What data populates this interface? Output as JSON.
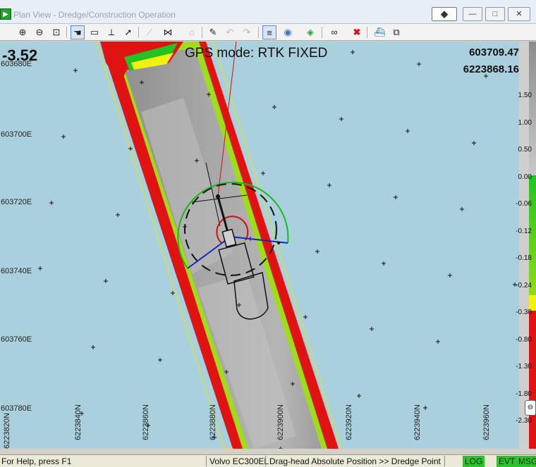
{
  "window": {
    "title": "Plan View - Dredge/Construction Operation",
    "pin_label": "◆",
    "minimize_label": "—",
    "maximize_label": "□",
    "close_label": "✕"
  },
  "toolbar": {
    "tools": [
      {
        "name": "zoom-in-icon",
        "glyph": "⊕"
      },
      {
        "name": "zoom-out-icon",
        "glyph": "⊖"
      },
      {
        "name": "zoom-window-icon",
        "glyph": "⊡"
      },
      {
        "name": "pan-hand-icon",
        "glyph": "☚"
      },
      {
        "name": "measure-icon",
        "glyph": "▭"
      },
      {
        "name": "ruler-icon",
        "glyph": "⟂"
      },
      {
        "name": "pointer-icon",
        "glyph": "➚"
      },
      {
        "name": "draw-line-icon",
        "glyph": "⟋"
      },
      {
        "name": "network-icon",
        "glyph": "⋈"
      },
      {
        "name": "house-icon",
        "glyph": "⌂"
      },
      {
        "name": "edit-icon",
        "glyph": "✎"
      },
      {
        "name": "undo-icon",
        "glyph": "↶"
      },
      {
        "name": "redo-icon",
        "glyph": "↷"
      },
      {
        "name": "layers-icon",
        "glyph": "≡"
      },
      {
        "name": "color-palette-icon",
        "glyph": "◉"
      },
      {
        "name": "paint-icon",
        "glyph": "◈"
      },
      {
        "name": "binoculars-icon",
        "glyph": "∞"
      },
      {
        "name": "delete-icon",
        "glyph": "✖"
      },
      {
        "name": "vessel-icon",
        "glyph": "⛴"
      },
      {
        "name": "windows-icon",
        "glyph": "⧉"
      }
    ]
  },
  "map": {
    "depth_value": "-3.52",
    "gps_mode": "GPS mode: RTK FIXED",
    "easting": "603709.47",
    "northing": "6223868.16",
    "easting_labels": [
      "603680E",
      "603700E",
      "603720E",
      "603740E",
      "603760E",
      "603780E"
    ],
    "northing_labels": [
      "6223820N",
      "6223840N",
      "6223860N",
      "6223880N",
      "6223900N",
      "6223920N",
      "6223940N",
      "6223960N"
    ]
  },
  "legend": {
    "labels": [
      "1.50",
      "1.00",
      "0.50",
      "0.00",
      "-0.06",
      "-0.12",
      "-0.18",
      "-0.24",
      "-0.30",
      "-0.80",
      "-1.30",
      "-1.80",
      "-2.30"
    ],
    "colors": {
      "gray_light": "#c8c8c8",
      "gray_mid": "#9a9a9a",
      "green": "#22c322",
      "lime": "#9fdc1b",
      "yellow": "#f1f10f",
      "red": "#e01313"
    }
  },
  "statusbar": {
    "help": "For Help, press F1",
    "machine": "Volvo EC300EL",
    "position": "Drag-head Absolute Position >> Dredge Point",
    "log": "LOG",
    "evt": "EVT",
    "msg": "MSG"
  }
}
